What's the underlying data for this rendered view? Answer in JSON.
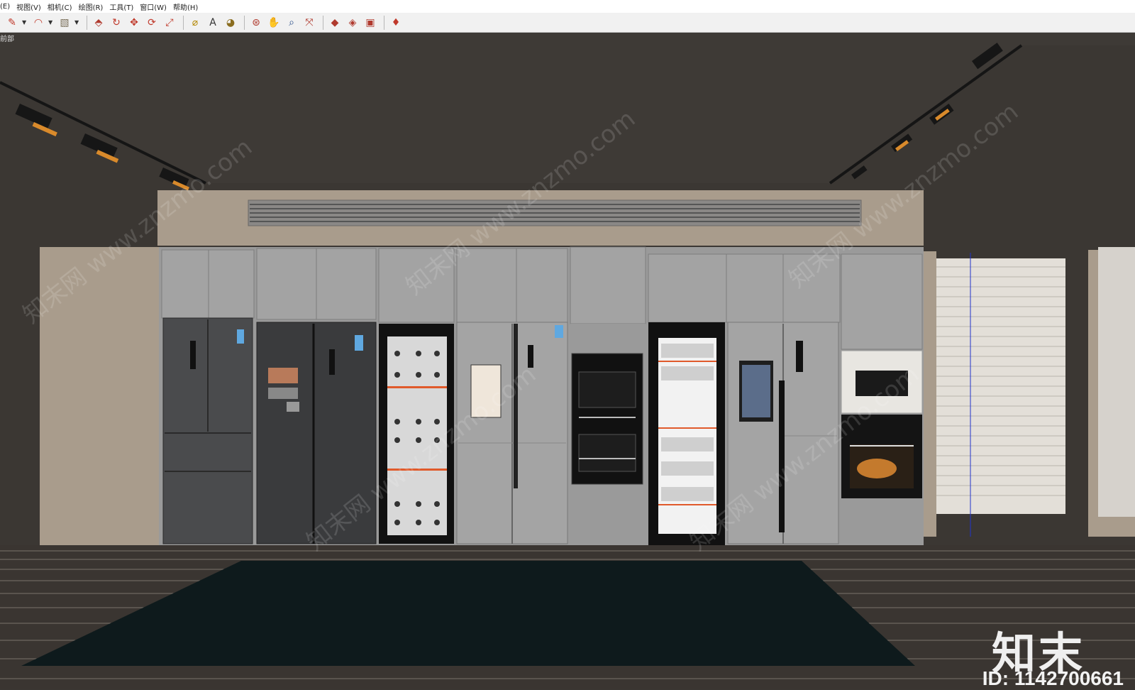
{
  "menu": [
    "(E)",
    "视图(V)",
    "相机(C)",
    "绘图(R)",
    "工具(T)",
    "窗口(W)",
    "帮助(H)"
  ],
  "toolbar": {
    "groups": [
      [
        {
          "name": "pencil-icon",
          "glyph": "✎",
          "color": "#c0392b",
          "dropdown": true
        },
        {
          "name": "arc-icon",
          "glyph": "◠",
          "color": "#c0392b",
          "dropdown": true
        },
        {
          "name": "shape-icon",
          "glyph": "▧",
          "color": "#7a6f5a",
          "dropdown": true
        }
      ],
      [
        {
          "name": "push-pull-icon",
          "glyph": "⬘",
          "color": "#b03a2e"
        },
        {
          "name": "follow-me-icon",
          "glyph": "↻",
          "color": "#c0392b"
        },
        {
          "name": "move-icon",
          "glyph": "✥",
          "color": "#c0392b"
        },
        {
          "name": "rotate-icon",
          "glyph": "⟳",
          "color": "#c0392b"
        },
        {
          "name": "scale-icon",
          "glyph": "⤢",
          "color": "#c0392b"
        }
      ],
      [
        {
          "name": "tape-measure-icon",
          "glyph": "⌀",
          "color": "#b38600"
        },
        {
          "name": "text-icon",
          "glyph": "A",
          "color": "#333"
        },
        {
          "name": "paint-bucket-icon",
          "glyph": "◕",
          "color": "#8a6d1f"
        }
      ],
      [
        {
          "name": "orbit-icon",
          "glyph": "⊛",
          "color": "#b03a2e"
        },
        {
          "name": "pan-icon",
          "glyph": "✋",
          "color": "#b38600"
        },
        {
          "name": "zoom-icon",
          "glyph": "⌕",
          "color": "#2b4f8a"
        },
        {
          "name": "zoom-extents-icon",
          "glyph": "⤧",
          "color": "#b03a2e"
        }
      ],
      [
        {
          "name": "warehouse-icon",
          "glyph": "◆",
          "color": "#b03a2e"
        },
        {
          "name": "share-model-icon",
          "glyph": "◈",
          "color": "#b03a2e"
        },
        {
          "name": "extension-icon",
          "glyph": "▣",
          "color": "#b03a2e"
        }
      ],
      [
        {
          "name": "ruby-icon",
          "glyph": "♦",
          "color": "#c0392b"
        }
      ]
    ]
  },
  "scene": {
    "label": "前部"
  },
  "watermark": {
    "site": "知末网 www.znzmo.com",
    "brand": "知末",
    "id": "ID: 1142700661"
  }
}
